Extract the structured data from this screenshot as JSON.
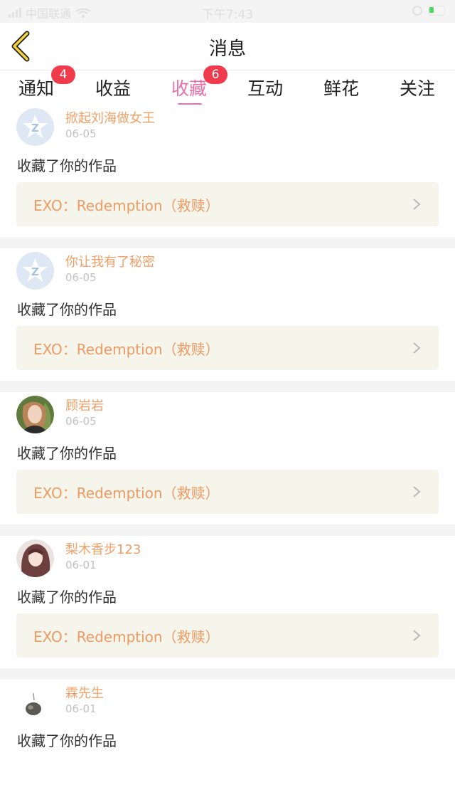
{
  "status_bar": {
    "carrier": "中国联通",
    "time": "下午7:43"
  },
  "header": {
    "title": "消息"
  },
  "tabs": [
    {
      "label": "通知",
      "badge": "4"
    },
    {
      "label": "收益"
    },
    {
      "label": "收藏",
      "badge": "6",
      "active": true
    },
    {
      "label": "互动"
    },
    {
      "label": "鲜花"
    },
    {
      "label": "关注"
    }
  ],
  "feed": [
    {
      "user": "掀起刘海做女王",
      "date": "06-05",
      "action": "收藏了你的作品",
      "work": "EXO：Redemption（救赎）",
      "avatar": "default-z-avatar"
    },
    {
      "user": "你让我有了秘密",
      "date": "06-05",
      "action": "收藏了你的作品",
      "work": "EXO：Redemption（救赎）",
      "avatar": "default-z-avatar"
    },
    {
      "user": "顾岩岩",
      "date": "06-05",
      "action": "收藏了你的作品",
      "work": "EXO：Redemption（救赎）",
      "avatar": "photo-avatar"
    },
    {
      "user": "梨木香步123",
      "date": "06-01",
      "action": "收藏了你的作品",
      "work": "EXO：Redemption（救赎）",
      "avatar": "anime-avatar"
    },
    {
      "user": "霖先生",
      "date": "06-01",
      "action": "收藏了你的作品",
      "work": "",
      "avatar": "photo-avatar"
    }
  ],
  "colors": {
    "accent": "#e871a9",
    "badge": "#f03b4c",
    "username": "#f0a066",
    "work_bg": "#f6f5ec"
  }
}
